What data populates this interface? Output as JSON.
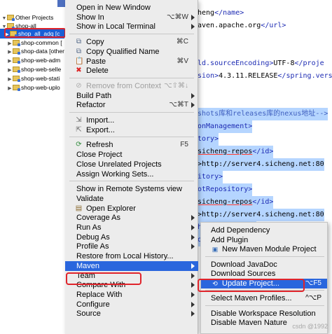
{
  "explorer": {
    "items": [
      {
        "label": "Other Projects",
        "arrow": "▼"
      },
      {
        "label": "shop-all",
        "arrow": "▼"
      },
      {
        "label": "shop_all_adq [c",
        "arrow": "▶"
      },
      {
        "label": "shop-common [",
        "arrow": "▶"
      },
      {
        "label": "shop-data [other",
        "arrow": "▶"
      },
      {
        "label": "shop-web-adm",
        "arrow": "▶"
      },
      {
        "label": "shop-web-selle",
        "arrow": "▶"
      },
      {
        "label": "shop-web-stati",
        "arrow": "▶"
      },
      {
        "label": "shop-web-uplo",
        "arrow": "▶"
      }
    ]
  },
  "editor": {
    "lines": [
      {
        "parts": [
          {
            "t": "heng",
            "c": "c-txt"
          },
          {
            "t": "</name>",
            "c": "c-tag"
          }
        ],
        "sel": false
      },
      {
        "parts": [
          {
            "t": "aven.apache.org",
            "c": "c-txt"
          },
          {
            "t": "</url>",
            "c": "c-tag"
          }
        ],
        "sel": false
      },
      {
        "parts": [],
        "sel": false
      },
      {
        "parts": [],
        "sel": false
      },
      {
        "parts": [
          {
            "t": "ld.sourceEncoding>",
            "c": "c-tag"
          },
          {
            "t": "UTF-8",
            "c": "c-txt"
          },
          {
            "t": "</proje",
            "c": "c-tag"
          }
        ],
        "sel": false
      },
      {
        "parts": [
          {
            "t": "sion>",
            "c": "c-tag"
          },
          {
            "t": "4.3.11.RELEASE",
            "c": "c-txt"
          },
          {
            "t": "</spring.vers",
            "c": "c-tag"
          }
        ],
        "sel": false
      },
      {
        "parts": [],
        "sel": false
      },
      {
        "parts": [],
        "sel": false
      },
      {
        "parts": [
          {
            "t": "shots库和releases库的nexus地址-->",
            "c": "c-cmt"
          }
        ],
        "sel": true
      },
      {
        "parts": [
          {
            "t": "onManagement>",
            "c": "c-tag"
          }
        ],
        "sel": true
      },
      {
        "parts": [
          {
            "t": "tory>",
            "c": "c-tag"
          }
        ],
        "sel": true
      },
      {
        "parts": [
          {
            "t": "sicheng-repos",
            "c": "c-txt c-red"
          },
          {
            "t": "</id>",
            "c": "c-tag"
          }
        ],
        "sel": true
      },
      {
        "parts": [
          {
            "t": ">http://server4.sicheng.net:80",
            "c": "c-txt"
          }
        ],
        "sel": true
      },
      {
        "parts": [
          {
            "t": "itory>",
            "c": "c-tag"
          }
        ],
        "sel": true
      },
      {
        "parts": [
          {
            "t": "otRepository>",
            "c": "c-tag"
          }
        ],
        "sel": true
      },
      {
        "parts": [
          {
            "t": "sicheng-repos",
            "c": "c-txt c-red"
          },
          {
            "t": "</id>",
            "c": "c-tag"
          }
        ],
        "sel": true
      },
      {
        "parts": [
          {
            "t": ">http://server4.sicheng.net:80",
            "c": "c-txt"
          }
        ],
        "sel": true
      },
      {
        "parts": [
          {
            "t": "hotRepository>",
            "c": "c-tag"
          }
        ],
        "sel": true
      },
      {
        "parts": [
          {
            "t": "onManagement>",
            "c": "c-tag"
          }
        ],
        "sel": true
      }
    ]
  },
  "context_menu": {
    "items": [
      {
        "label": "Open in New Window"
      },
      {
        "label": "Show In",
        "shortcut": "⌥⌘W",
        "submenu": true
      },
      {
        "label": "Show in Local Terminal",
        "submenu": true
      },
      {
        "sep": true
      },
      {
        "label": "Copy",
        "shortcut": "⌘C",
        "icon": "copy-icon"
      },
      {
        "label": "Copy Qualified Name",
        "icon": "copy-qualified-icon"
      },
      {
        "label": "Paste",
        "shortcut": "⌘V",
        "icon": "paste-icon"
      },
      {
        "label": "Delete",
        "icon": "delete-icon"
      },
      {
        "sep": true
      },
      {
        "label": "Remove from Context",
        "shortcut": "⌥⇧⌘↓",
        "icon": "remove-context-icon",
        "disabled": true
      },
      {
        "label": "Build Path",
        "submenu": true
      },
      {
        "label": "Refactor",
        "shortcut": "⌥⌘T",
        "submenu": true
      },
      {
        "sep": true
      },
      {
        "label": "Import...",
        "icon": "import-icon"
      },
      {
        "label": "Export...",
        "icon": "export-icon"
      },
      {
        "sep": true
      },
      {
        "label": "Refresh",
        "shortcut": "F5",
        "icon": "refresh-icon"
      },
      {
        "label": "Close Project"
      },
      {
        "label": "Close Unrelated Projects"
      },
      {
        "label": "Assign Working Sets..."
      },
      {
        "sep": true
      },
      {
        "label": "Show in Remote Systems view"
      },
      {
        "label": "Validate"
      },
      {
        "label": "Open Explorer",
        "icon": "open-explorer-icon"
      },
      {
        "label": "Coverage As",
        "submenu": true
      },
      {
        "label": "Run As",
        "submenu": true
      },
      {
        "label": "Debug As",
        "submenu": true
      },
      {
        "label": "Profile As",
        "submenu": true
      },
      {
        "label": "Restore from Local History..."
      },
      {
        "label": "Maven",
        "submenu": true,
        "active": true
      },
      {
        "label": "Team",
        "submenu": true
      },
      {
        "label": "Compare With",
        "submenu": true
      },
      {
        "label": "Replace With",
        "submenu": true
      },
      {
        "label": "Configure",
        "submenu": true
      },
      {
        "label": "Source",
        "submenu": true
      }
    ]
  },
  "maven_submenu": {
    "items": [
      {
        "label": "Add Dependency"
      },
      {
        "label": "Add Plugin"
      },
      {
        "label": "New Maven Module Project",
        "icon": "maven-module-icon"
      },
      {
        "sep": true
      },
      {
        "label": "Download JavaDoc"
      },
      {
        "label": "Download Sources"
      },
      {
        "label": "Update Project...",
        "shortcut": "⌥F5",
        "icon": "update-project-icon",
        "active": true
      },
      {
        "sep": true
      },
      {
        "label": "Select Maven Profiles...",
        "shortcut": "^⌥P"
      },
      {
        "sep": true
      },
      {
        "label": "Disable Workspace Resolution"
      },
      {
        "label": "Disable Maven Nature"
      }
    ]
  },
  "watermark": "csdn @1992"
}
